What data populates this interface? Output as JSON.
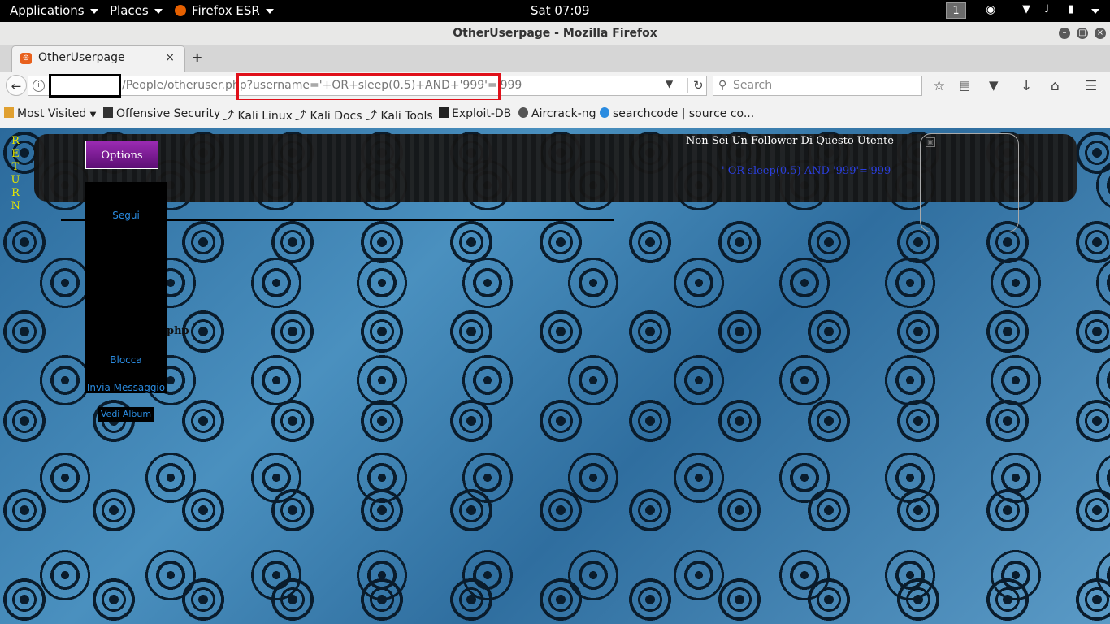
{
  "topbar": {
    "applications": "Applications",
    "places": "Places",
    "browser": "Firefox ESR",
    "clock": "Sat 07:09",
    "workspace": "1"
  },
  "window": {
    "title": "OtherUserpage - Mozilla Firefox"
  },
  "tab": {
    "label": "OtherUserpage",
    "close": "×",
    "new_tab": "+"
  },
  "navbar": {
    "url_path": "/People/otheruser.php?username='+OR+sleep(0.5)+AND+'999'='999",
    "search_placeholder": "Search"
  },
  "bookmarks": [
    {
      "label": "Most Visited",
      "icon": "folder-icon"
    },
    {
      "label": "Offensive Security",
      "icon": "offsec-icon"
    },
    {
      "label": "Kali Linux",
      "icon": "kali-icon"
    },
    {
      "label": "Kali Docs",
      "icon": "kali-icon"
    },
    {
      "label": "Kali Tools",
      "icon": "kali-icon"
    },
    {
      "label": "Exploit-DB",
      "icon": "exploitdb-icon"
    },
    {
      "label": "Aircrack-ng",
      "icon": "aircrack-icon"
    },
    {
      "label": "searchcode | source co...",
      "icon": "searchcode-icon"
    }
  ],
  "page": {
    "return_label": "RETURN",
    "options_button": "Options",
    "menu": {
      "follow": "Segui",
      "block": "Blocca",
      "send_message": "Invia Messaggio",
      "view_album": "Vedi Album"
    },
    "stray_text": "php",
    "not_follower": "Non Sei Un Follower Di Questo Utente",
    "username_display": "' OR sleep(0.5) AND '999'='999"
  },
  "colors": {
    "highlight": "#e0101a",
    "options_purple": "#7a1a94",
    "link_blue": "#2a8be0",
    "return_yellow": "#e6e600"
  }
}
